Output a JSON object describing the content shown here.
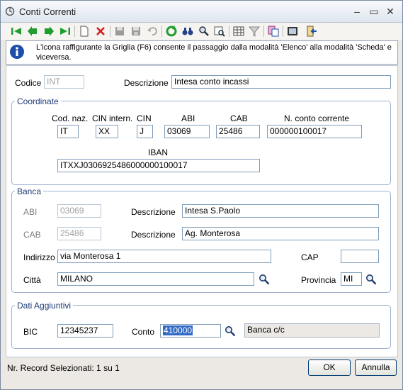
{
  "window": {
    "title": "Conti Correnti",
    "minimize": "–",
    "maximize": "▭",
    "close": "✕"
  },
  "info": {
    "text": "L'icona raffigurante la Griglia (F6) consente il passaggio dalla modalità 'Elenco' alla modalità 'Scheda' e viceversa."
  },
  "header": {
    "codice_label": "Codice",
    "codice_value": "INT",
    "descrizione_label": "Descrizione",
    "descrizione_value": "Intesa conto incassi"
  },
  "coordinate": {
    "title": "Coordinate",
    "cod_naz_label": "Cod. naz.",
    "cod_naz_value": "IT",
    "cin_intern_label": "CIN intern.",
    "cin_intern_value": "XX",
    "cin_label": "CIN",
    "cin_value": "J",
    "abi_label": "ABI",
    "abi_value": "03069",
    "cab_label": "CAB",
    "cab_value": "25486",
    "conto_label": "N. conto corrente",
    "conto_value": "000000100017",
    "iban_label": "IBAN",
    "iban_value": "ITXXJ0306925486000000100017"
  },
  "banca": {
    "title": "Banca",
    "abi_label": "ABI",
    "abi_value": "03069",
    "abi_desc_label": "Descrizione",
    "abi_desc_value": "Intesa S.Paolo",
    "cab_label": "CAB",
    "cab_value": "25486",
    "cab_desc_label": "Descrizione",
    "cab_desc_value": "Ag. Monterosa",
    "indirizzo_label": "Indirizzo",
    "indirizzo_value": "via Monterosa 1",
    "cap_label": "CAP",
    "cap_value": "",
    "citta_label": "Città",
    "citta_value": "MILANO",
    "provincia_label": "Provincia",
    "provincia_value": "MI"
  },
  "dati": {
    "title": "Dati Aggiuntivi",
    "bic_label": "BIC",
    "bic_value": "12345237",
    "conto_label": "Conto",
    "conto_value": "410000",
    "conto_desc": "Banca c/c"
  },
  "footer": {
    "status": "Nr. Record Selezionati: 1 su 1",
    "ok": "OK",
    "annulla": "Annulla"
  },
  "toolbar_icons": [
    "first-record-icon",
    "previous-record-icon",
    "next-record-icon",
    "last-record-icon",
    "new-record-icon",
    "delete-record-icon",
    "save-icon",
    "save-as-icon",
    "undo-icon",
    "refresh-icon",
    "find-icon",
    "search-icon",
    "filter-search-icon",
    "grid-icon",
    "filter-icon",
    "copy-icon",
    "view-icon",
    "exit-icon"
  ]
}
